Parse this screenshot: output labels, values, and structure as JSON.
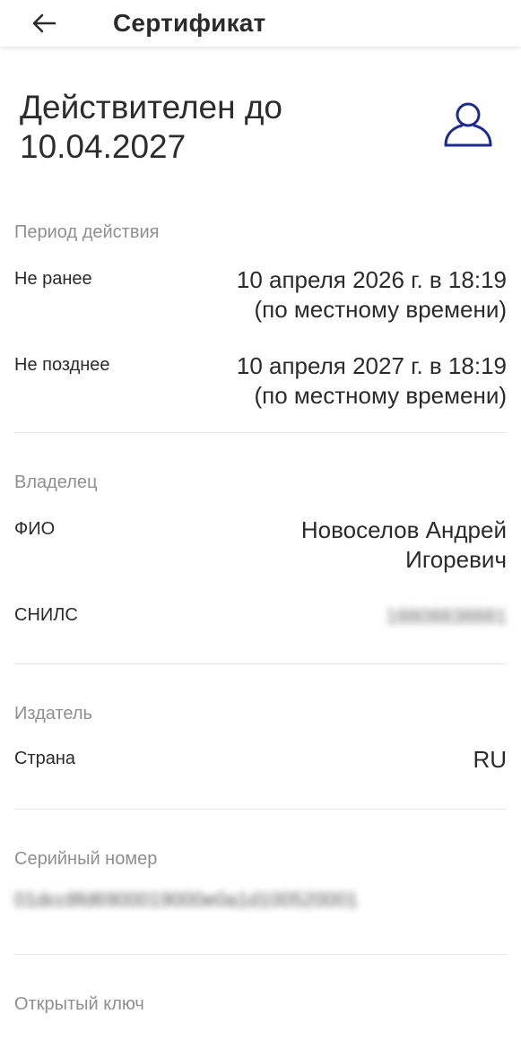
{
  "header": {
    "back_icon": "arrow-left-icon",
    "title": "Сертификат"
  },
  "hero": {
    "title": "Действителен до 10.04.2027",
    "avatar_icon": "user-outline-icon",
    "accent_color": "#1d2b8f"
  },
  "validity": {
    "title": "Период действия",
    "not_before_label": "Не ранее",
    "not_before_value": "10 апреля 2026 г. в 18:19 (по местному времени)",
    "not_after_label": "Не позднее",
    "not_after_value": "10 апреля 2027 г. в 18:19 (по местному времени)"
  },
  "owner": {
    "title": "Владелец",
    "fio_label": "ФИО",
    "fio_value": "Новоселов Андрей Игоревич",
    "snils_label": "СНИЛС",
    "snils_value": "18808838881"
  },
  "issuer": {
    "title": "Издатель",
    "country_label": "Страна",
    "country_value": "RU"
  },
  "serial": {
    "title": "Серийный номер",
    "value": "01dcc8fd6900019000e0a1d100520001"
  },
  "public_key": {
    "title": "Открытый ключ"
  }
}
